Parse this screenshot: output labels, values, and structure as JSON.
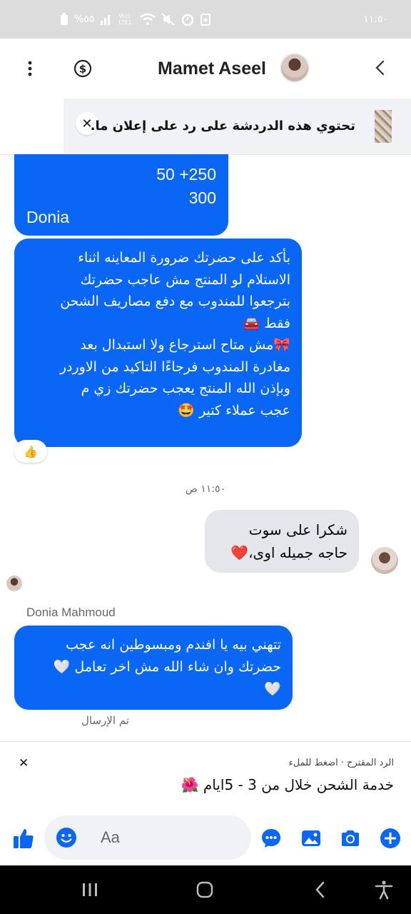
{
  "status_bar": {
    "battery": "%٥٥",
    "network": "Vo)) LTE1",
    "time": "١١:٥٠"
  },
  "header": {
    "title": "Mamet Aseel",
    "icons": [
      "more-vertical-icon",
      "dollar-circle-icon",
      "back-chevron-icon"
    ]
  },
  "banner": {
    "text": "تحتوي هذه الدردشة على رد على إعلان ما.",
    "close_label": "✕"
  },
  "messages": {
    "m1": {
      "line0": "…",
      "line1": "50 +250",
      "line2": "300",
      "signature": "Donia"
    },
    "m2": {
      "text": "بأكد على حضرتك ضرورة المعاينه اثناء\nالاستلام لو المنتج مش عاجب حضرتك\nبترجعوا للمندوب مع دفع مصاريف الشحن\nفقط 🚘\n🎀مش متاح استرجاع ولا استبدال بعد\nمغادرة المندوب فرجاءًا التاكيد من الاوردر\nوبإذن الله المنتج يعجب حضرتك زي م\nعجب عملاء كتير 🤩",
      "reaction": "👍"
    },
    "timestamp": "١١:٥٠ ص",
    "m3": {
      "text": "شكرا على سوت\nحاجه جميله اوى،❤️"
    },
    "sender_name": "Donia Mahmoud",
    "m4": {
      "text": "تتهني بيه يا افندم ومبسوطين انه عجب\nحضرتك وان شاء الله مش اخر تعامل 🤍\n🤍"
    },
    "sent_status": "تم الإرسال"
  },
  "suggested_reply": {
    "label": "الرد المقترح · اضغط للملء",
    "text": "خدمة الشحن خلال من 3 - 5ايام 🌺",
    "close_label": "✕"
  },
  "composer": {
    "placeholder": "Aa"
  },
  "colors": {
    "accent": "#0a66f5",
    "incoming_bubble": "#e4e6eb"
  }
}
